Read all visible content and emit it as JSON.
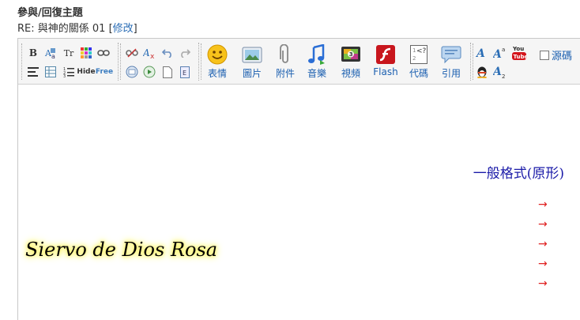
{
  "header": {
    "title": "參與/回復主題",
    "subtitle_prefix": "RE: 與神的關係 01 [",
    "subtitle_link": "修改",
    "subtitle_suffix": "]"
  },
  "toolbar": {
    "bold": "B",
    "font_size": "Tr",
    "hide": "Hide",
    "free": "Free",
    "big_buttons": {
      "emoticon": "表情",
      "image": "圖片",
      "attachment": "附件",
      "music": "音樂",
      "video": "視頻",
      "flash": "Flash",
      "code": "代碼",
      "quote": "引用"
    },
    "source_label": "源碼"
  },
  "content": {
    "format_label": "一般格式(原形)",
    "arrows": [
      "→",
      "→",
      "→",
      "→",
      "→"
    ],
    "signature": "Siervo de Dios Rosa"
  },
  "colors": {
    "link": "#2a6db5",
    "toolbar_bg": "#f5f5f5",
    "arrow": "#e02020",
    "format_text": "#1a1aa8",
    "signature_glow": "#fff45a"
  }
}
